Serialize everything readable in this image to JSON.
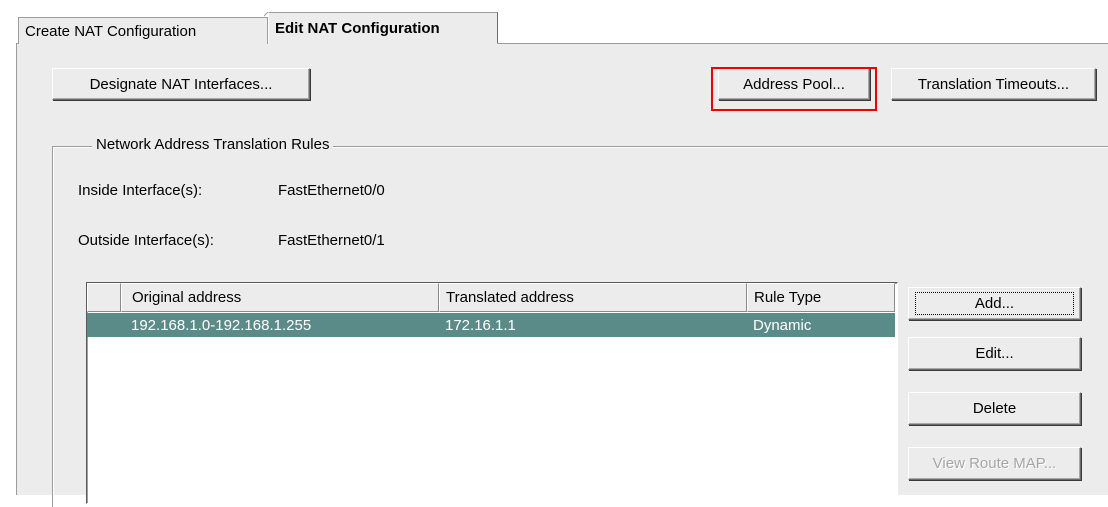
{
  "tabs": [
    {
      "label": "Create NAT Configuration",
      "active": false
    },
    {
      "label": "Edit NAT Configuration",
      "active": true
    }
  ],
  "toolbar": {
    "designate_label": "Designate NAT Interfaces...",
    "address_pool_label": "Address Pool...",
    "translation_timeouts_label": "Translation Timeouts..."
  },
  "rules": {
    "legend": "Network Address Translation Rules",
    "inside_label": "Inside Interface(s):",
    "inside_value": "FastEthernet0/0",
    "outside_label": "Outside Interface(s):",
    "outside_value": "FastEthernet0/1",
    "columns": [
      "Original address",
      "Translated address",
      "Rule Type"
    ],
    "rows": [
      {
        "original": "192.168.1.0-192.168.1.255",
        "translated": "172.16.1.1",
        "type": "Dynamic",
        "selected": true
      }
    ],
    "buttons": {
      "add": "Add...",
      "edit": "Edit...",
      "delete": "Delete",
      "view_route_map": "View Route MAP..."
    }
  },
  "colors": {
    "selection": "#5b8b88",
    "highlight_box": "#ee0000",
    "panel": "#ececec"
  }
}
